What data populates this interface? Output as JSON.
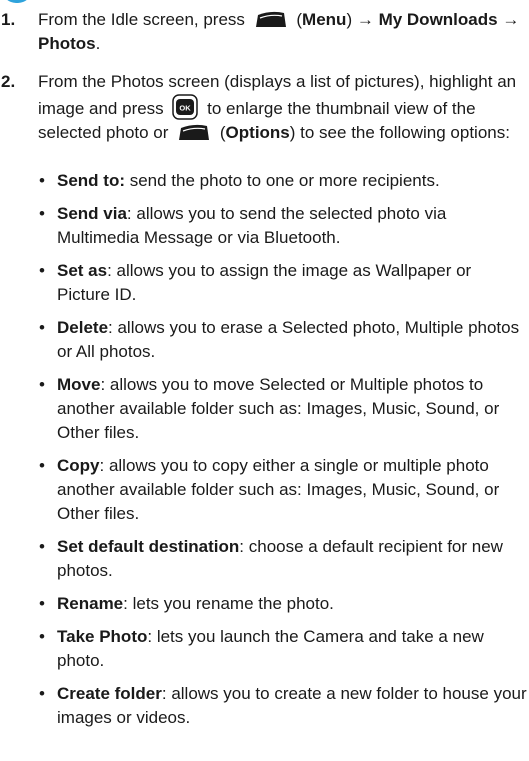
{
  "steps": [
    {
      "number": "1.",
      "parts": {
        "a": "From the Idle screen, press",
        "menu_label": "Menu",
        "arrow1": "→",
        "my_downloads": "My Downloads",
        "arrow2": "→",
        "photos": "Photos",
        "period": "."
      }
    },
    {
      "number": "2.",
      "parts": {
        "a": "From the Photos screen (displays a list of pictures), highlight an image and press",
        "b": "to enlarge the thumbnail view of the selected photo or",
        "options_label": "Options",
        "c": "to see the following options:"
      }
    }
  ],
  "options": [
    {
      "term": "Send to:",
      "desc": " send the photo to one or more recipients."
    },
    {
      "term": "Send via",
      "desc": ": allows you to send the selected photo via Multimedia Message or via Bluetooth."
    },
    {
      "term": "Set as",
      "desc": ": allows you to assign the image as Wallpaper or Picture ID."
    },
    {
      "term": "Delete",
      "desc": ": allows you to erase a Selected photo, Multiple photos or All photos."
    },
    {
      "term": "Move",
      "desc": ": allows you to move Selected or Multiple photos to another available folder such as: Images, Music, Sound, or Other files."
    },
    {
      "term": "Copy",
      "desc": ": allows you to copy either a single or multiple photo another available folder such as: Images, Music, Sound, or Other files."
    },
    {
      "term": "Set default destination",
      "desc": ": choose a default recipient for new photos."
    },
    {
      "term": "Rename",
      "desc": ": lets you rename the photo."
    },
    {
      "term": "Take Photo",
      "desc": ": lets you launch the Camera and take a new photo."
    },
    {
      "term": "Create folder",
      "desc": ": allows you to create a new folder to house your images or videos."
    }
  ],
  "icons": {
    "soft_key": "left-soft-key-icon",
    "ok_key": "ok-key-icon",
    "ok_text": "OK"
  },
  "colors": {
    "accent": "#2fa3dc",
    "key": "#1a1a1a"
  }
}
